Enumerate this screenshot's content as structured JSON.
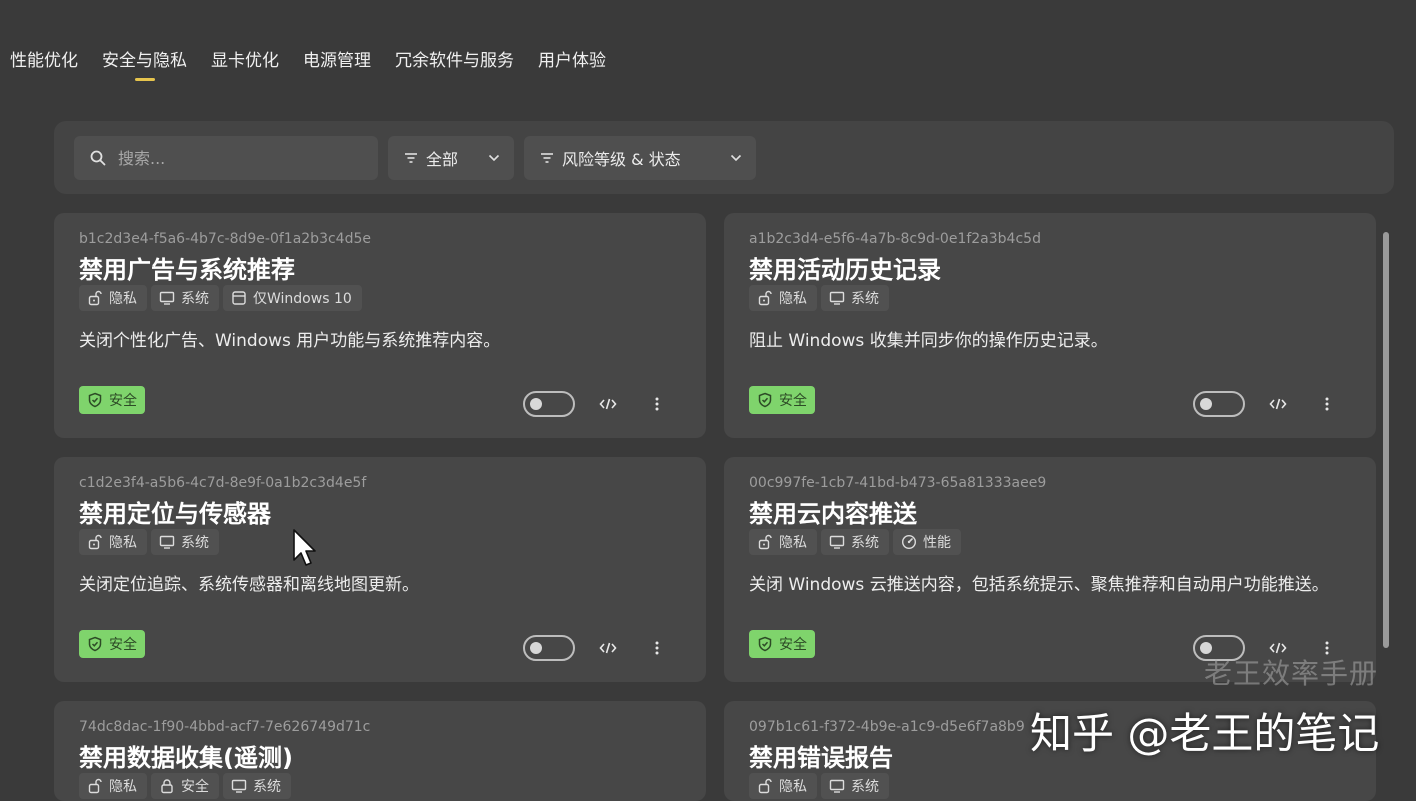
{
  "tabs": [
    "性能优化",
    "安全与隐私",
    "显卡优化",
    "电源管理",
    "冗余软件与服务",
    "用户体验"
  ],
  "active_tab": "安全与隐私",
  "toolbar": {
    "search_placeholder": "搜索...",
    "filter_all": "全部",
    "filter_risk": "风险等级 & 状态"
  },
  "cards": [
    {
      "id": "b1c2d3e4-f5a6-4b7c-8d9e-0f1a2b3c4d5e",
      "title": "禁用广告与系统推荐",
      "tags": [
        {
          "icon": "privacy-icon",
          "label": "隐私"
        },
        {
          "icon": "system-icon",
          "label": "系统"
        },
        {
          "icon": "windows-version-icon",
          "label": "仅Windows 10"
        }
      ],
      "description": "关闭个性化广告、Windows 用户功能与系统推荐内容。",
      "badge": "安全",
      "enabled": false
    },
    {
      "id": "a1b2c3d4-e5f6-4a7b-8c9d-0e1f2a3b4c5d",
      "title": "禁用活动历史记录",
      "tags": [
        {
          "icon": "privacy-icon",
          "label": "隐私"
        },
        {
          "icon": "system-icon",
          "label": "系统"
        }
      ],
      "description": "阻止 Windows 收集并同步你的操作历史记录。",
      "badge": "安全",
      "enabled": false
    },
    {
      "id": "c1d2e3f4-a5b6-4c7d-8e9f-0a1b2c3d4e5f",
      "title": "禁用定位与传感器",
      "tags": [
        {
          "icon": "privacy-icon",
          "label": "隐私"
        },
        {
          "icon": "system-icon",
          "label": "系统"
        }
      ],
      "description": "关闭定位追踪、系统传感器和离线地图更新。",
      "badge": "安全",
      "enabled": false
    },
    {
      "id": "00c997fe-1cb7-41bd-b473-65a81333aee9",
      "title": "禁用云内容推送",
      "tags": [
        {
          "icon": "privacy-icon",
          "label": "隐私"
        },
        {
          "icon": "system-icon",
          "label": "系统"
        },
        {
          "icon": "performance-icon",
          "label": "性能"
        }
      ],
      "description": "关闭 Windows 云推送内容，包括系统提示、聚焦推荐和自动用户功能推送。",
      "badge": "安全",
      "enabled": false
    },
    {
      "id": "74dc8dac-1f90-4bbd-acf7-7e626749d71c",
      "title": "禁用数据收集(遥测)",
      "tags": [
        {
          "icon": "privacy-icon",
          "label": "隐私"
        },
        {
          "icon": "security-icon",
          "label": "安全"
        },
        {
          "icon": "system-icon",
          "label": "系统"
        }
      ]
    },
    {
      "id": "097b1c61-f372-4b9e-a1c9-d5e6f7a8b9",
      "title": "禁用错误报告",
      "tags": [
        {
          "icon": "privacy-icon",
          "label": "隐私"
        },
        {
          "icon": "system-icon",
          "label": "系统"
        }
      ]
    }
  ],
  "watermark": {
    "channel": "老王效率手册",
    "source": "知乎 @老王的笔记"
  },
  "colors": {
    "background": "#3a3a3a",
    "card": "#474747",
    "safe_badge": "#7fd46c",
    "active_tab_indicator": "#e6c44d"
  }
}
